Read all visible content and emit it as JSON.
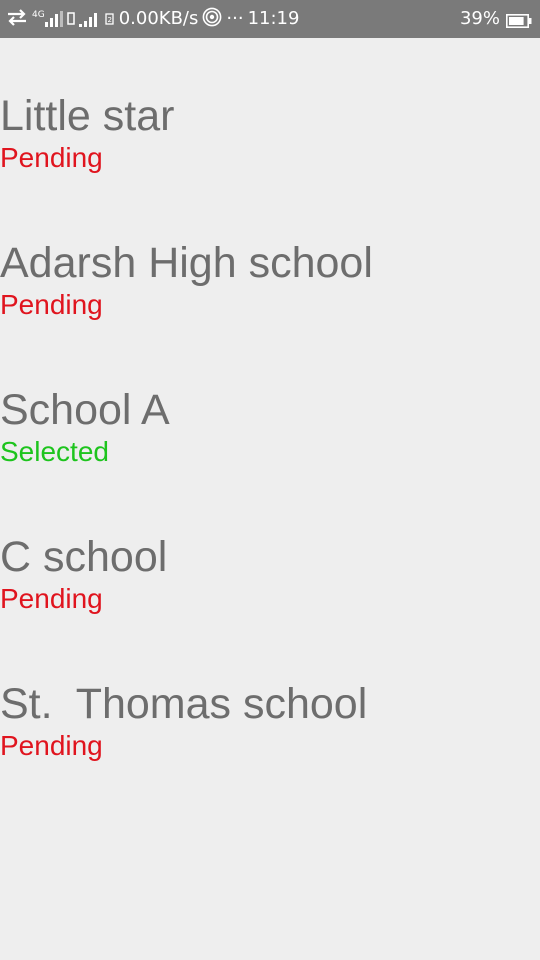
{
  "status_bar": {
    "net_type": "4G",
    "data_speed": "0.00KB/s",
    "more": "···",
    "time": "11:19",
    "battery_percent": "39%",
    "battery_level": 0.39
  },
  "colors": {
    "pending": "#e0141e",
    "selected": "#1dc41d",
    "title": "#6d6d6d",
    "background": "#eeeeee",
    "status_bar": "#7a7a7a"
  },
  "schools": [
    {
      "name": "Little star",
      "status": "Pending"
    },
    {
      "name": "Adarsh High school",
      "status": "Pending"
    },
    {
      "name": "School A",
      "status": "Selected"
    },
    {
      "name": "C school",
      "status": "Pending"
    },
    {
      "name": "St.  Thomas school",
      "status": "Pending"
    }
  ]
}
